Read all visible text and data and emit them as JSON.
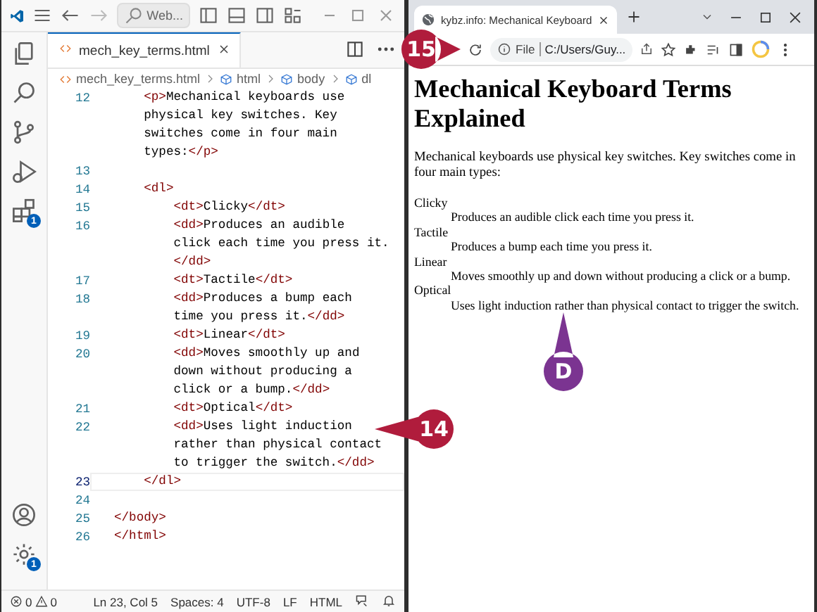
{
  "editor": {
    "command_center": "Web...",
    "activity_bar": [
      {
        "kind": "explorer"
      },
      {
        "kind": "search"
      },
      {
        "kind": "source-control"
      },
      {
        "kind": "run"
      },
      {
        "kind": "extensions",
        "badge": "1"
      }
    ],
    "activity_bar_bottom": [
      {
        "kind": "accounts"
      },
      {
        "kind": "manage",
        "badge": "1"
      }
    ],
    "tab": {
      "label": "mech_key_terms.html"
    },
    "breadcrumbs": [
      "mech_key_terms.html",
      "html",
      "body",
      "dl"
    ],
    "lines": [
      {
        "number": "12",
        "current": false,
        "segments": [
          {
            "kind": "tag",
            "text": "    <p>"
          },
          {
            "kind": "text",
            "text": "Mechanical keyboards use"
          }
        ]
      },
      {
        "current": false,
        "segments": [
          {
            "kind": "text",
            "text": "    physical key switches. Key"
          }
        ]
      },
      {
        "current": false,
        "segments": [
          {
            "kind": "text",
            "text": "    switches come in four main"
          }
        ]
      },
      {
        "current": false,
        "segments": [
          {
            "kind": "text",
            "text": "    types:"
          },
          {
            "kind": "tag",
            "text": "</p>"
          }
        ]
      },
      {
        "number": "13",
        "current": false
      },
      {
        "number": "14",
        "current": false,
        "segments": [
          {
            "kind": "tag",
            "text": "    <dl>"
          }
        ]
      },
      {
        "number": "15",
        "current": false,
        "segments": [
          {
            "kind": "tag",
            "text": "        <dt>"
          },
          {
            "kind": "text",
            "text": "Clicky"
          },
          {
            "kind": "tag",
            "text": "</dt>"
          }
        ]
      },
      {
        "number": "16",
        "current": false,
        "segments": [
          {
            "kind": "tag",
            "text": "        <dd>"
          },
          {
            "kind": "text",
            "text": "Produces an audible"
          }
        ]
      },
      {
        "current": false,
        "segments": [
          {
            "kind": "text",
            "text": "        click each time you press it."
          }
        ]
      },
      {
        "current": false,
        "segments": [
          {
            "kind": "tag",
            "text": "        </dd>"
          }
        ]
      },
      {
        "number": "17",
        "current": false,
        "segments": [
          {
            "kind": "tag",
            "text": "        <dt>"
          },
          {
            "kind": "text",
            "text": "Tactile"
          },
          {
            "kind": "tag",
            "text": "</dt>"
          }
        ]
      },
      {
        "number": "18",
        "current": false,
        "segments": [
          {
            "kind": "tag",
            "text": "        <dd>"
          },
          {
            "kind": "text",
            "text": "Produces a bump each"
          }
        ]
      },
      {
        "current": false,
        "segments": [
          {
            "kind": "text",
            "text": "        time you press it."
          },
          {
            "kind": "tag",
            "text": "</dd>"
          }
        ]
      },
      {
        "number": "19",
        "current": false,
        "segments": [
          {
            "kind": "tag",
            "text": "        <dt>"
          },
          {
            "kind": "text",
            "text": "Linear"
          },
          {
            "kind": "tag",
            "text": "</dt>"
          }
        ]
      },
      {
        "number": "20",
        "current": false,
        "segments": [
          {
            "kind": "tag",
            "text": "        <dd>"
          },
          {
            "kind": "text",
            "text": "Moves smoothly up and"
          }
        ]
      },
      {
        "current": false,
        "segments": [
          {
            "kind": "text",
            "text": "        down without producing a"
          }
        ]
      },
      {
        "current": false,
        "segments": [
          {
            "kind": "text",
            "text": "        click or a bump."
          },
          {
            "kind": "tag",
            "text": "</dd>"
          }
        ]
      },
      {
        "number": "21",
        "current": false,
        "segments": [
          {
            "kind": "tag",
            "text": "        <dt>"
          },
          {
            "kind": "text",
            "text": "Optical"
          },
          {
            "kind": "tag",
            "text": "</dt>"
          }
        ]
      },
      {
        "number": "22",
        "current": false,
        "segments": [
          {
            "kind": "tag",
            "text": "        <dd>"
          },
          {
            "kind": "text",
            "text": "Uses light induction"
          }
        ]
      },
      {
        "current": false,
        "segments": [
          {
            "kind": "text",
            "text": "        rather than physical contact"
          }
        ]
      },
      {
        "current": false,
        "segments": [
          {
            "kind": "text",
            "text": "        to trigger the switch."
          },
          {
            "kind": "tag",
            "text": "</dd>"
          }
        ]
      },
      {
        "number": "23",
        "current": true,
        "segments": [
          {
            "kind": "tag",
            "text": "    </dl>"
          }
        ]
      },
      {
        "number": "24",
        "current": false
      },
      {
        "number": "25",
        "current": false,
        "segments": [
          {
            "kind": "tag",
            "text": "</body>"
          }
        ]
      },
      {
        "number": "26",
        "current": false,
        "segments": [
          {
            "kind": "tag",
            "text": "</html>"
          }
        ]
      }
    ],
    "status_bar": {
      "errors": "0",
      "warnings": "0",
      "items": [
        "Ln 23, Col 5",
        "Spaces: 4",
        "UTF-8",
        "LF",
        "HTML"
      ]
    }
  },
  "browser": {
    "tab_title": "kybz.info: Mechanical Keyboard",
    "address_scheme": "File",
    "address": "C:/Users/Guy...",
    "page": {
      "heading": "Mechanical Keyboard Terms Explained",
      "intro": "Mechanical keyboards use physical key switches. Key switches come in four main types:",
      "terms": [
        {
          "term": "Clicky",
          "definition": "Produces an audible click each time you press it."
        },
        {
          "term": "Tactile",
          "definition": "Produces a bump each time you press it."
        },
        {
          "term": "Linear",
          "definition": "Moves smoothly up and down without producing a click or a bump."
        },
        {
          "term": "Optical",
          "definition": "Uses light induction rather than physical contact to trigger the switch."
        }
      ]
    }
  },
  "callouts": [
    {
      "label": "15",
      "color": "#b01c3c"
    },
    {
      "label": "14",
      "color": "#b01c3c"
    },
    {
      "label": "D",
      "color": "#7b3491"
    }
  ]
}
